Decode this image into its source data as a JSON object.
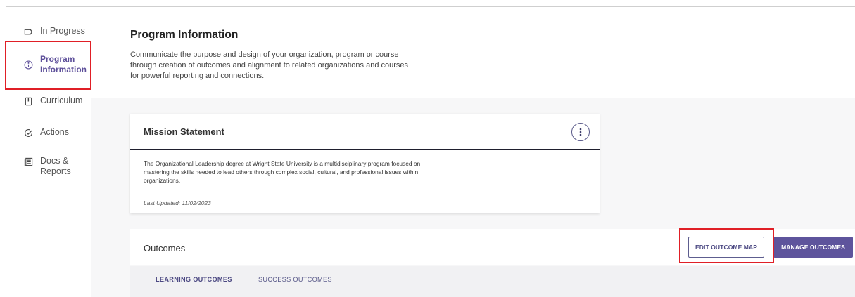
{
  "sidebar": {
    "items": [
      {
        "label": "In Progress",
        "icon": "tag-icon"
      },
      {
        "label": "Program Information",
        "icon": "info-icon",
        "active": true
      },
      {
        "label": "Curriculum",
        "icon": "book-icon"
      },
      {
        "label": "Actions",
        "icon": "check-circle-icon"
      },
      {
        "label": "Docs & Reports",
        "icon": "document-icon"
      }
    ]
  },
  "header": {
    "title": "Program Information",
    "description": "Communicate the purpose and design of your organization, program or course through creation of outcomes and alignment to related organizations and courses for powerful reporting and connections."
  },
  "mission": {
    "title": "Mission Statement",
    "text": "The Organizational Leadership degree at Wright State University is a multidisciplinary program focused on mastering the skills needed to lead others through complex social, cultural, and professional issues within organizations.",
    "updated": "Last Updated: 11/02/2023"
  },
  "outcomes": {
    "title": "Outcomes",
    "edit_label": "EDIT OUTCOME MAP",
    "manage_label": "MANAGE OUTCOMES",
    "tabs": [
      {
        "label": "LEARNING OUTCOMES",
        "active": true
      },
      {
        "label": "SUCCESS OUTCOMES",
        "active": false
      }
    ]
  },
  "colors": {
    "accent": "#5e549c",
    "highlight": "#e01f26"
  }
}
